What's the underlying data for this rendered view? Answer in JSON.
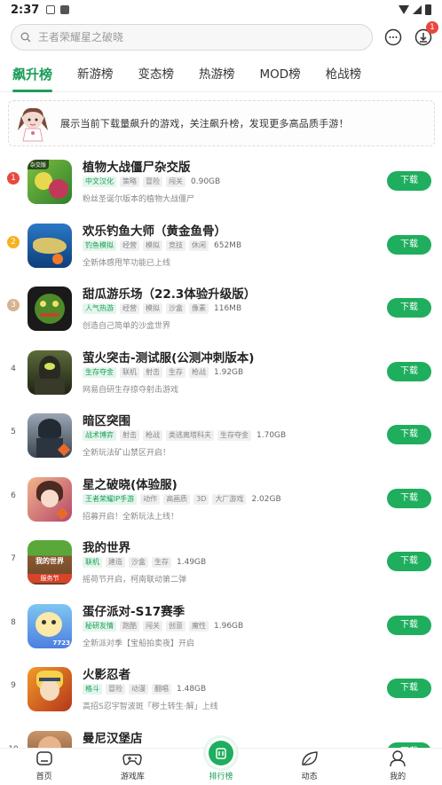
{
  "status_bar": {
    "time": "2:37"
  },
  "search": {
    "placeholder": "王者荣耀星之破晓",
    "badge_count": "1"
  },
  "tabs": [
    {
      "label": "飙升榜",
      "active": true
    },
    {
      "label": "新游榜"
    },
    {
      "label": "变态榜"
    },
    {
      "label": "热游榜"
    },
    {
      "label": "MOD榜"
    },
    {
      "label": "枪战榜"
    }
  ],
  "notice": {
    "text": "展示当前下载量飙升的游戏，关注飙升榜，发现更多高品质手游！"
  },
  "download_label": "下载",
  "games": [
    {
      "rank": "1",
      "title": "植物大战僵尸杂交版",
      "tags": [
        "中文汉化",
        "策略",
        "冒险",
        "闯关"
      ],
      "size": "0.90GB",
      "desc": "粉丝圣诞尔版本的植物大战僵尸",
      "thumb_label": "杂交版"
    },
    {
      "rank": "2",
      "title": "欢乐钓鱼大师（黄金鱼骨）",
      "tags": [
        "钓鱼模拟",
        "经营",
        "模拟",
        "竞技",
        "休闲"
      ],
      "size": "652MB",
      "desc": "全新体感甩竿功能已上线"
    },
    {
      "rank": "3",
      "title": "甜瓜游乐场（22.3体验升级版）",
      "tags": [
        "人气热游",
        "经营",
        "模拟",
        "沙盒",
        "像素"
      ],
      "size": "116MB",
      "desc": "创造自己简单的沙盒世界"
    },
    {
      "rank": "4",
      "title": "萤火突击-测试服(公测冲刺版本)",
      "tags": [
        "生存夺金",
        "联机",
        "射击",
        "生存",
        "枪战"
      ],
      "size": "1.92GB",
      "desc": "网易自研生存掠夺射击游戏"
    },
    {
      "rank": "5",
      "title": "暗区突围",
      "tags": [
        "战术博弈",
        "射击",
        "枪战",
        "类逃离塔科夫",
        "生存夺金"
      ],
      "size": "1.70GB",
      "desc": "全新玩法矿山禁区开启！"
    },
    {
      "rank": "6",
      "title": "星之破晓(体验服)",
      "tags": [
        "王者荣耀IP手游",
        "动作",
        "高画质",
        "3D",
        "大厂游戏"
      ],
      "size": "2.02GB",
      "desc": "招募开启！全新玩法上线！"
    },
    {
      "rank": "7",
      "title": "我的世界",
      "tags": [
        "联机",
        "建造",
        "沙盒",
        "生存"
      ],
      "size": "1.49GB",
      "desc": "摇荷节开启，柯南联动第二弹",
      "thumb_label": "我的世界",
      "thumb_sub": "服务节"
    },
    {
      "rank": "8",
      "title": "蛋仔派对-S17赛季",
      "tags": [
        "秘研友情",
        "跑酷",
        "闯关",
        "创意",
        "魔性"
      ],
      "size": "1.96GB",
      "desc": "全新派对季【宝船拍卖夜】开启",
      "thumb_label": "7723"
    },
    {
      "rank": "9",
      "title": "火影忍者",
      "tags": [
        "格斗",
        "冒险",
        "动漫",
        "翻唱"
      ],
      "size": "1.48GB",
      "desc": "高招S忍宇智波斑「秽土转生·解」上线"
    },
    {
      "rank": "10",
      "title": "曼尼汉堡店",
      "tags": [],
      "size": "",
      "desc": ""
    }
  ],
  "bottom_nav": [
    {
      "label": "首页",
      "icon": "home-icon"
    },
    {
      "label": "游戏库",
      "icon": "gamepad-icon"
    },
    {
      "label": "排行榜",
      "icon": "ranking-icon",
      "active": true
    },
    {
      "label": "动态",
      "icon": "leaf-icon"
    },
    {
      "label": "我的",
      "icon": "profile-icon"
    }
  ],
  "colors": {
    "accent": "#1fae5d",
    "rank1": "#e8483f",
    "rank2": "#f5b21b",
    "rank3": "#d6b38f"
  }
}
